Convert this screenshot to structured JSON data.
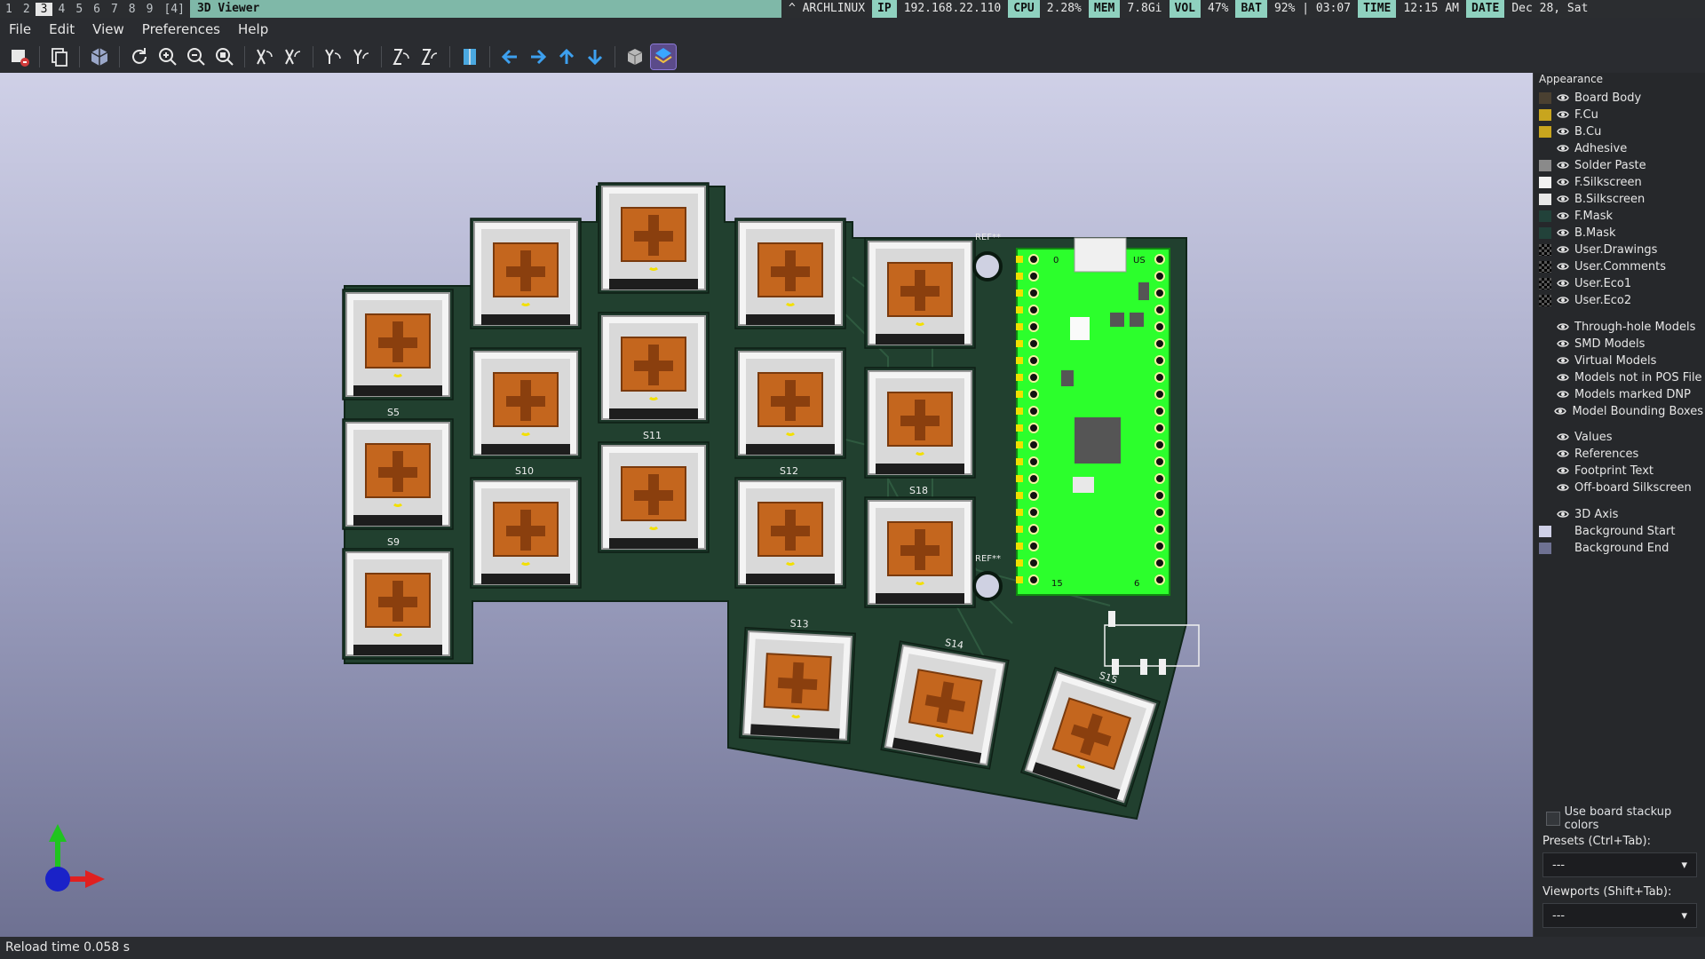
{
  "statusbar": {
    "workspaces": [
      "1",
      "2",
      "3",
      "4",
      "5",
      "6",
      "7",
      "8",
      "9",
      "[4]"
    ],
    "active_workspace_index": 2,
    "window_title": "3D Viewer",
    "distro": "^ ARCHLINUX",
    "ip_key": "IP",
    "ip_val": "192.168.22.110",
    "cpu_key": "CPU",
    "cpu_val": "2.28%",
    "mem_key": "MEM",
    "mem_val": "7.8Gi",
    "vol_key": "VOL",
    "vol_val": "47%",
    "bat_key": "BAT",
    "bat_val": "92% | 03:07",
    "time_key": "TIME",
    "time_val": "12:15 AM",
    "date_key": "DATE",
    "date_val": "Dec 28, Sat"
  },
  "menu": [
    "File",
    "Edit",
    "View",
    "Preferences",
    "Help"
  ],
  "toolbar_icons": [
    "export-image-icon",
    "copy-icon",
    "board-3d-icon",
    "reload-icon",
    "zoom-in-icon",
    "zoom-out-icon",
    "zoom-fit-icon",
    "rotate-x-cw-icon",
    "rotate-x-ccw-icon",
    "rotate-y-cw-icon",
    "rotate-y-ccw-icon",
    "rotate-z-cw-icon",
    "rotate-z-ccw-icon",
    "flip-board-icon",
    "pan-left-icon",
    "pan-right-icon",
    "pan-up-icon",
    "pan-down-icon",
    "ortho-icon",
    "raytrace-icon"
  ],
  "viewport": {
    "switch_labels": [
      "S5",
      "S9",
      "S10",
      "S11",
      "S12",
      "S18",
      "S13",
      "S14",
      "S15"
    ],
    "ref_labels": [
      "REF**",
      "REF**"
    ],
    "pico_pin_labels": [
      "0",
      "15",
      "6",
      "US"
    ]
  },
  "panel": {
    "title": "Appearance",
    "layers": [
      {
        "label": "Board Body",
        "color": "#4a4031"
      },
      {
        "label": "F.Cu",
        "color": "#c8a51e"
      },
      {
        "label": "B.Cu",
        "color": "#c8a51e"
      },
      {
        "label": "Adhesive",
        "color": ""
      },
      {
        "label": "Solder Paste",
        "color": "#8a8a8a"
      },
      {
        "label": "F.Silkscreen",
        "color": "#f2f2f2"
      },
      {
        "label": "B.Silkscreen",
        "color": "#e8e8e8"
      },
      {
        "label": "F.Mask",
        "color": "#22423a"
      },
      {
        "label": "B.Mask",
        "color": "#22423a"
      },
      {
        "label": "User.Drawings",
        "color": "checker"
      },
      {
        "label": "User.Comments",
        "color": "checker"
      },
      {
        "label": "User.Eco1",
        "color": "checker"
      },
      {
        "label": "User.Eco2",
        "color": "checker"
      }
    ],
    "models": [
      "Through-hole Models",
      "SMD Models",
      "Virtual Models",
      "Models not in POS File",
      "Models marked DNP",
      "Model Bounding Boxes"
    ],
    "texts": [
      "Values",
      "References",
      "Footprint Text",
      "Off-board Silkscreen"
    ],
    "misc": [
      {
        "label": "3D Axis",
        "color": ""
      },
      {
        "label": "Background Start",
        "color": "#cfd0e7"
      },
      {
        "label": "Background End",
        "color": "#6e7192"
      }
    ],
    "stackup_label": "Use board stackup colors",
    "presets_label": "Presets (Ctrl+Tab):",
    "presets_value": "---",
    "viewports_label": "Viewports (Shift+Tab):",
    "viewports_value": "---"
  },
  "bottom_status": "Reload time 0.058 s"
}
